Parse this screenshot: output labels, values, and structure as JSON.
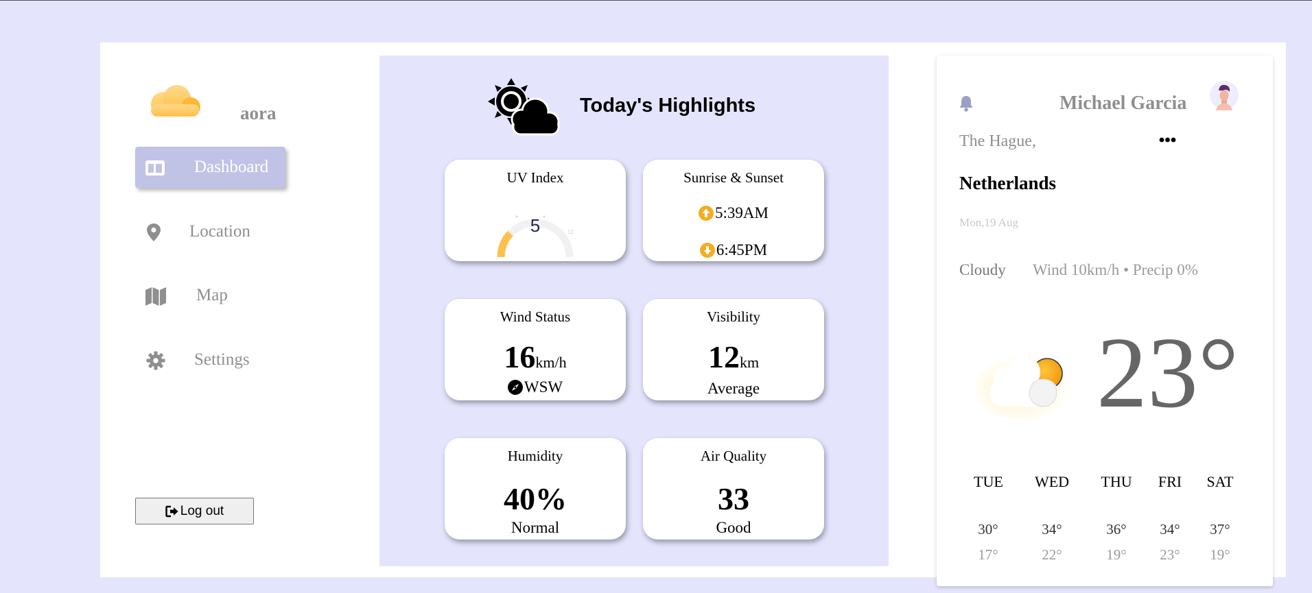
{
  "app": {
    "brand": "aora"
  },
  "sidebar": {
    "items": [
      {
        "label": "Dashboard",
        "icon": "dashboard-icon",
        "active": true
      },
      {
        "label": "Location",
        "icon": "location-pin-icon"
      },
      {
        "label": "Map",
        "icon": "map-icon"
      },
      {
        "label": "Settings",
        "icon": "gear-icon"
      }
    ],
    "logout_label": "Log out"
  },
  "highlights": {
    "title": "Today's Highlights",
    "uv": {
      "title": "UV Index",
      "value": "5",
      "level": 5,
      "max": 12
    },
    "sun": {
      "title": "Sunrise & Sunset",
      "sunrise": "5:39AM",
      "sunset": "6:45PM"
    },
    "wind": {
      "title": "Wind Status",
      "value": "16",
      "unit": "km/h",
      "direction": "WSW"
    },
    "visibility": {
      "title": "Visibility",
      "value": "12",
      "unit": "km",
      "status": "Average"
    },
    "humidity": {
      "title": "Humidity",
      "value": "40%",
      "status": "Normal"
    },
    "air": {
      "title": "Air Quality",
      "value": "33",
      "status": "Good"
    }
  },
  "profile": {
    "name": "Michael Garcia",
    "city": "The Hague,",
    "country": "Netherlands",
    "date": "Mon,19 Aug",
    "condition": "Cloudy",
    "details": "Wind 10km/h • Precip 0%",
    "temperature": "23°"
  },
  "forecast": [
    {
      "day": "TUE",
      "high": "30°",
      "low": "17°"
    },
    {
      "day": "WED",
      "high": "34°",
      "low": "22°"
    },
    {
      "day": "THU",
      "high": "36°",
      "low": "19°"
    },
    {
      "day": "FRI",
      "high": "34°",
      "low": "23°"
    },
    {
      "day": "SAT",
      "high": "37°",
      "low": "19°"
    }
  ],
  "colors": {
    "background": "#e4e5fd",
    "active_nav": "#c0c3e5",
    "sun_orange": "#f5ad1f",
    "muted_text": "#8f8f8f"
  }
}
